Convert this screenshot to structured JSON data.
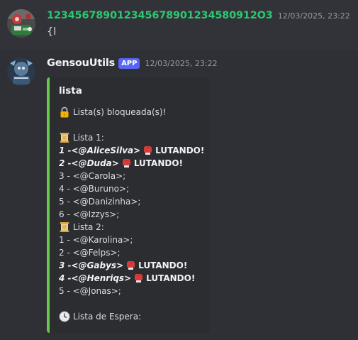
{
  "messages": [
    {
      "username": "123456789012345678901234580912O3",
      "timestamp": "12/03/2025, 23:22",
      "content": "{l"
    },
    {
      "username": "GensouUtils",
      "badge": "APP",
      "timestamp": "12/03/2025, 23:22",
      "embed": {
        "title": "lista",
        "accent_color": "#66c94a",
        "locked_text": "Lista(s) bloqueada(s)!",
        "list1_label": "Lista 1:",
        "list1": [
          {
            "text": "1 -<@AliceSilva>",
            "status": "LUTANDO!"
          },
          {
            "text": "2 -<@Duda>",
            "status": "LUTANDO!"
          },
          {
            "text": "3 - <@Carola>;"
          },
          {
            "text": "4 - <@Buruno>;"
          },
          {
            "text": "5 - <@Danizinha>;"
          },
          {
            "text": "6 - <@Izzys>;"
          }
        ],
        "list2_label": "Lista 2:",
        "list2": [
          {
            "text": "1 - <@Karolina>;"
          },
          {
            "text": "2 - <@Felps>;"
          },
          {
            "text": "3 -<@Gabys>",
            "status": "LUTANDO!"
          },
          {
            "text": "4 -<@Henriqs>",
            "status": "LUTANDO!"
          },
          {
            "text": "5 - <@Jonas>;"
          }
        ],
        "waiting_label": "Lista de Espera:"
      }
    }
  ],
  "icons": {
    "lock": "lock-icon",
    "scroll": "scroll-icon",
    "glove": "boxing-glove-icon",
    "clock": "clock-icon"
  }
}
